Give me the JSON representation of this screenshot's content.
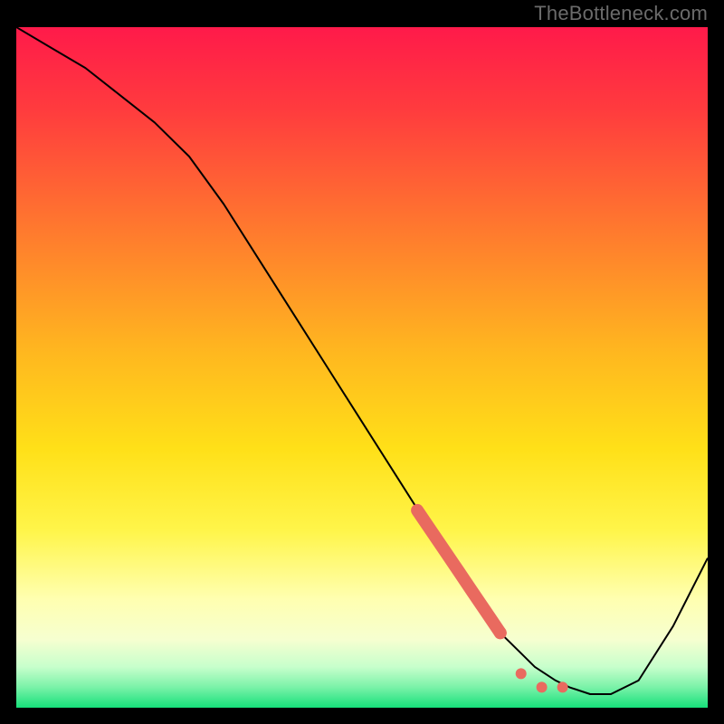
{
  "watermark": "TheBottleneck.com",
  "colors": {
    "page_bg": "#000000",
    "watermark": "#6b6b6b",
    "line": "#000000",
    "marker": "#e96a5f",
    "gradient_top": "#ff1a4a",
    "gradient_mid": "#ffd400",
    "gradient_low": "#ffffc0",
    "gradient_bottom": "#16e07a"
  },
  "chart_data": {
    "type": "line",
    "title": "",
    "xlabel": "",
    "ylabel": "",
    "xlim": [
      0,
      100
    ],
    "ylim": [
      0,
      100
    ],
    "grid": false,
    "legend": false,
    "series": [
      {
        "name": "curve",
        "x": [
          0,
          5,
          10,
          15,
          20,
          25,
          30,
          35,
          40,
          45,
          50,
          55,
          60,
          62,
          65,
          68,
          70,
          73,
          75,
          78,
          80,
          83,
          86,
          90,
          95,
          100
        ],
        "y": [
          100,
          97,
          94,
          90,
          86,
          81,
          74,
          66,
          58,
          50,
          42,
          34,
          26,
          23,
          18,
          14,
          11,
          8,
          6,
          4,
          3,
          2,
          2,
          4,
          12,
          22
        ]
      }
    ],
    "highlight_segment": {
      "name": "highlighted-points",
      "x": [
        58,
        60,
        62,
        64,
        66,
        68,
        70,
        73,
        76,
        79
      ],
      "y": [
        29,
        26,
        23,
        20,
        17,
        14,
        11,
        5,
        3,
        3
      ]
    }
  }
}
